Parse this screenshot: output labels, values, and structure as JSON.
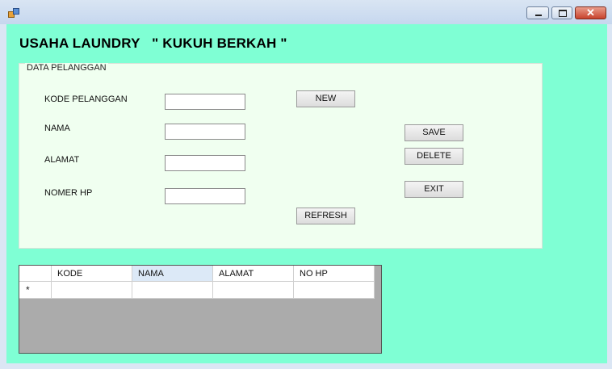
{
  "window": {
    "title": "",
    "controls": {
      "minimize_icon": "minimize-icon",
      "maximize_icon": "maximize-icon",
      "close_icon": "close-icon",
      "close_glyph": "✕"
    }
  },
  "app": {
    "heading": "USAHA LAUNDRY   \" KUKUH BERKAH \""
  },
  "group": {
    "label": "DATA PELANGGAN",
    "fields": [
      {
        "label": "KODE PELANGGAN",
        "value": ""
      },
      {
        "label": "NAMA",
        "value": ""
      },
      {
        "label": "ALAMAT",
        "value": ""
      },
      {
        "label": "NOMER HP",
        "value": ""
      }
    ],
    "buttons": {
      "new": "NEW",
      "refresh": "REFRESH",
      "save": "SAVE",
      "delete": "DELETE",
      "exit": "EXIT"
    }
  },
  "grid": {
    "columns": [
      "KODE",
      "NAMA",
      "ALAMAT",
      "NO HP"
    ],
    "selected_column": "NAMA",
    "new_row_marker": "*",
    "rows": []
  },
  "colors": {
    "form_background": "#7fffd4",
    "group_background": "#f0fff0",
    "grid_background": "#ababab"
  }
}
